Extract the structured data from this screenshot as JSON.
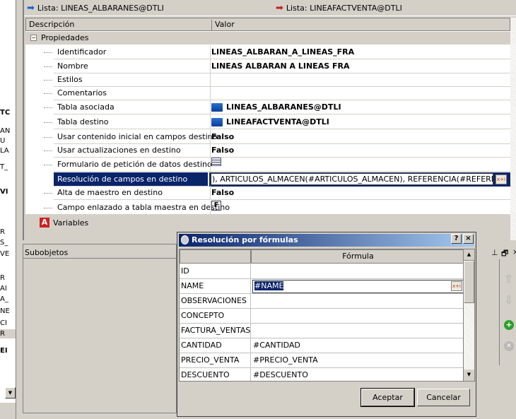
{
  "left_strip": {
    "fragments": [
      "TC",
      "AN",
      "U",
      "LA",
      "T_",
      "VI",
      "R",
      "S_",
      "VE",
      "R",
      "AI",
      "A_",
      "NE",
      "CI",
      "R",
      "EI"
    ]
  },
  "top": {
    "source_list": "Lista: LINEAS_ALBARANES@DTLI",
    "target_list": "Lista: LINEAFACTVENTA@DTLI"
  },
  "grid": {
    "col_desc": "Descripción",
    "col_value": "Valor",
    "group": "Propiedades",
    "variables": "Variables",
    "rows": [
      {
        "desc": "Identificador",
        "value": "LINEAS_ALBARAN_A_LINEAS_FRA"
      },
      {
        "desc": "Nombre",
        "value": "LINEAS ALBARAN A LINEAS FRA"
      },
      {
        "desc": "Estilos",
        "value": ""
      },
      {
        "desc": "Comentarios",
        "value": ""
      },
      {
        "desc": "Tabla asociada",
        "value": "LINEAS_ALBARANES@DTLI",
        "icon": "folder"
      },
      {
        "desc": "Tabla destino",
        "value": "LINEAFACTVENTA@DTLI",
        "icon": "folder"
      },
      {
        "desc": "Usar contenido inicial en campos destino",
        "value": "Falso"
      },
      {
        "desc": "Usar actualizaciones en destino",
        "value": "Falso"
      },
      {
        "desc": "Formulario de petición de datos destino",
        "value": "",
        "icon": "form"
      },
      {
        "desc": "Resolución de campos en destino",
        "value": "), ARTICULOS_ALMACEN(#ARTICULOS_ALMACEN), REFERENCIA(#REFERENCIA)",
        "selected": true
      },
      {
        "desc": "Alta de maestro en destino",
        "value": "Falso"
      },
      {
        "desc": "Campo enlazado a tabla maestra en destino",
        "value": "",
        "icon": "F"
      }
    ]
  },
  "subobjetos": {
    "label": "Subobjetos"
  },
  "dialog": {
    "title": "Resolución por fórmulas",
    "help": "?",
    "close": "×",
    "col_formula": "Fórmula",
    "rows": [
      {
        "name": "ID",
        "formula": ""
      },
      {
        "name": "NAME",
        "formula": "#NAME",
        "editing": true
      },
      {
        "name": "OBSERVACIONES",
        "formula": ""
      },
      {
        "name": "CONCEPTO",
        "formula": ""
      },
      {
        "name": "FACTURA_VENTAS",
        "formula": ""
      },
      {
        "name": "CANTIDAD",
        "formula": "#CANTIDAD"
      },
      {
        "name": "PRECIO_VENTA",
        "formula": "#PRECIO_VENTA"
      },
      {
        "name": "DESCUENTO",
        "formula": "#DESCUENTO"
      }
    ],
    "ok": "Aceptar",
    "cancel": "Cancelar",
    "fx": "x+i"
  }
}
